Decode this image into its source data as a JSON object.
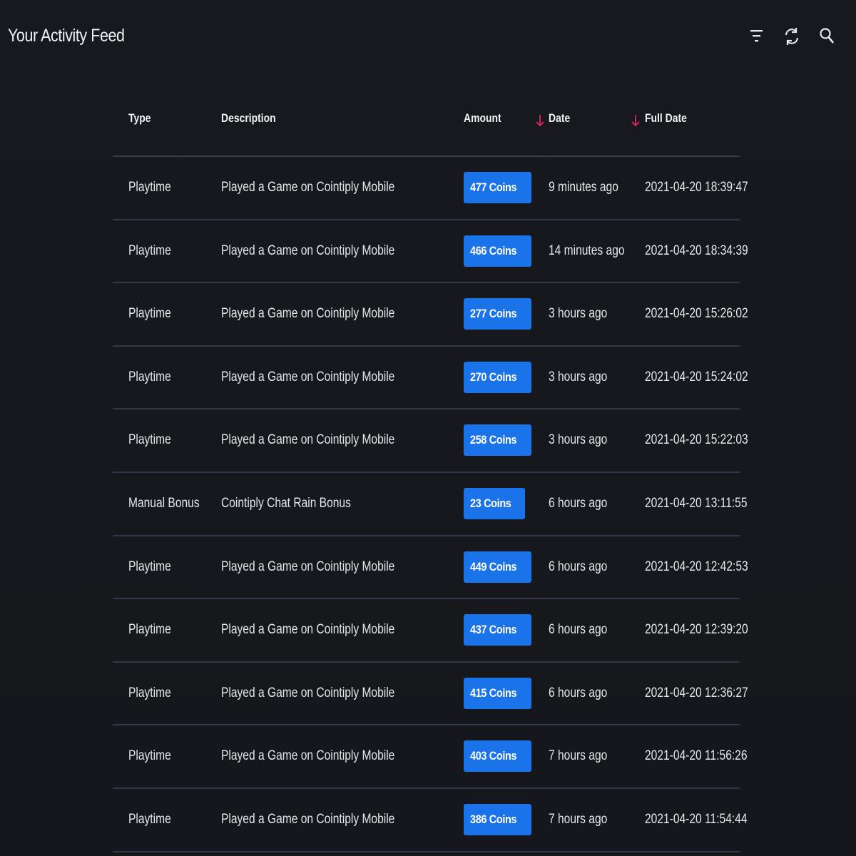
{
  "header": {
    "title": "Your Activity Feed",
    "icons": [
      "filter-icon",
      "refresh-icon",
      "search-icon"
    ]
  },
  "colors": {
    "background": "#16181d",
    "badge": "#1a73e8",
    "sort_arrow": "#e0245e",
    "divider": "#34364a"
  },
  "table": {
    "columns": {
      "type": "Type",
      "description": "Description",
      "amount": "Amount",
      "date": "Date",
      "full_date": "Full Date"
    },
    "rows": [
      {
        "type": "Playtime",
        "description": "Played a Game on Cointiply Mobile",
        "amount": "477 Coins",
        "date": "9 minutes ago",
        "full_date": "2021-04-20 18:39:47"
      },
      {
        "type": "Playtime",
        "description": "Played a Game on Cointiply Mobile",
        "amount": "466 Coins",
        "date": "14 minutes ago",
        "full_date": "2021-04-20 18:34:39"
      },
      {
        "type": "Playtime",
        "description": "Played a Game on Cointiply Mobile",
        "amount": "277 Coins",
        "date": "3 hours ago",
        "full_date": "2021-04-20 15:26:02"
      },
      {
        "type": "Playtime",
        "description": "Played a Game on Cointiply Mobile",
        "amount": "270 Coins",
        "date": "3 hours ago",
        "full_date": "2021-04-20 15:24:02"
      },
      {
        "type": "Playtime",
        "description": "Played a Game on Cointiply Mobile",
        "amount": "258 Coins",
        "date": "3 hours ago",
        "full_date": "2021-04-20 15:22:03"
      },
      {
        "type": "Manual Bonus",
        "description": "Cointiply Chat Rain Bonus",
        "amount": "23 Coins",
        "date": "6 hours ago",
        "full_date": "2021-04-20 13:11:55"
      },
      {
        "type": "Playtime",
        "description": "Played a Game on Cointiply Mobile",
        "amount": "449 Coins",
        "date": "6 hours ago",
        "full_date": "2021-04-20 12:42:53"
      },
      {
        "type": "Playtime",
        "description": "Played a Game on Cointiply Mobile",
        "amount": "437 Coins",
        "date": "6 hours ago",
        "full_date": "2021-04-20 12:39:20"
      },
      {
        "type": "Playtime",
        "description": "Played a Game on Cointiply Mobile",
        "amount": "415 Coins",
        "date": "6 hours ago",
        "full_date": "2021-04-20 12:36:27"
      },
      {
        "type": "Playtime",
        "description": "Played a Game on Cointiply Mobile",
        "amount": "403 Coins",
        "date": "7 hours ago",
        "full_date": "2021-04-20 11:56:26"
      },
      {
        "type": "Playtime",
        "description": "Played a Game on Cointiply Mobile",
        "amount": "386 Coins",
        "date": "7 hours ago",
        "full_date": "2021-04-20 11:54:44"
      }
    ]
  }
}
